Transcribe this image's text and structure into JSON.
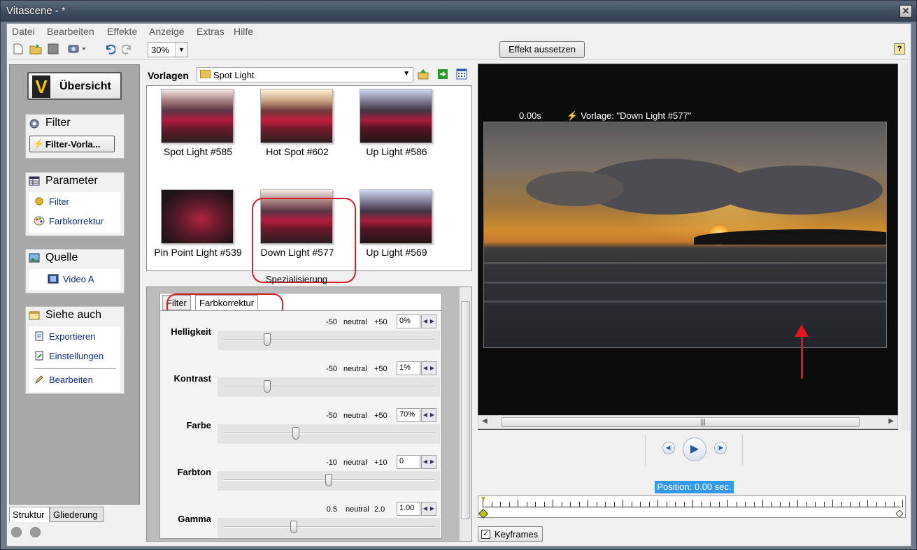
{
  "window": {
    "title": "Vitascene - *",
    "close_glyph": "✕"
  },
  "menu": [
    "Datei",
    "Bearbeiten",
    "Effekte",
    "Anzeige",
    "Extras",
    "Hilfe"
  ],
  "toolbar": {
    "zoom": "30%",
    "effekt_button": "Effekt aussetzen",
    "help_glyph": "?"
  },
  "left_panel": {
    "uebersicht_label": "Übersicht",
    "filter_section": {
      "title": "Filter",
      "button": "Filter-Vorla..."
    },
    "parameter_section": {
      "title": "Parameter",
      "items": [
        "Filter",
        "Farbkorrektur"
      ]
    },
    "quelle_section": {
      "title": "Quelle",
      "items": [
        "Video A"
      ]
    },
    "siehe_auch_section": {
      "title": "Siehe auch",
      "items": [
        "Exportieren",
        "Einstellungen",
        "Bearbeiten"
      ]
    },
    "bottom_tabs": [
      "Struktur",
      "Gliederung"
    ]
  },
  "vorlagen": {
    "label": "Vorlagen",
    "selected_folder": "Spot Light",
    "thumbnails": [
      "Spot Light #585",
      "Hot Spot #602",
      "Up Light #586",
      "Pin Point Light #539",
      "Down Light #577",
      "Up Light #569"
    ],
    "selected_index": 4
  },
  "spezialisierung": {
    "label": "Spezialisierung",
    "tabs": [
      "Filter",
      "Farbkorrektur"
    ],
    "active_tab": "Farbkorrektur",
    "mid_label": "neutral",
    "sliders": [
      {
        "name": "Helligkeit",
        "min": "-50",
        "max": "+50",
        "value": "0%",
        "position": 0.2
      },
      {
        "name": "Kontrast",
        "min": "-50",
        "max": "+50",
        "value": "1%",
        "position": 0.2
      },
      {
        "name": "Farbe",
        "min": "-50",
        "max": "+50",
        "value": "70%",
        "position": 0.34
      },
      {
        "name": "Farbton",
        "min": "-10",
        "max": "+10",
        "value": "0",
        "position": 0.5
      },
      {
        "name": "Gamma",
        "min": "0.5",
        "max": "2.0",
        "value": "1.00",
        "position": 0.33
      }
    ]
  },
  "preview": {
    "time": "0.00s",
    "vorlage": "Vorlage: \"Down Light #577\""
  },
  "transport": {
    "position": "Position: 0.00 sec."
  },
  "keyframes": {
    "label": "Keyframes",
    "checked": true
  }
}
